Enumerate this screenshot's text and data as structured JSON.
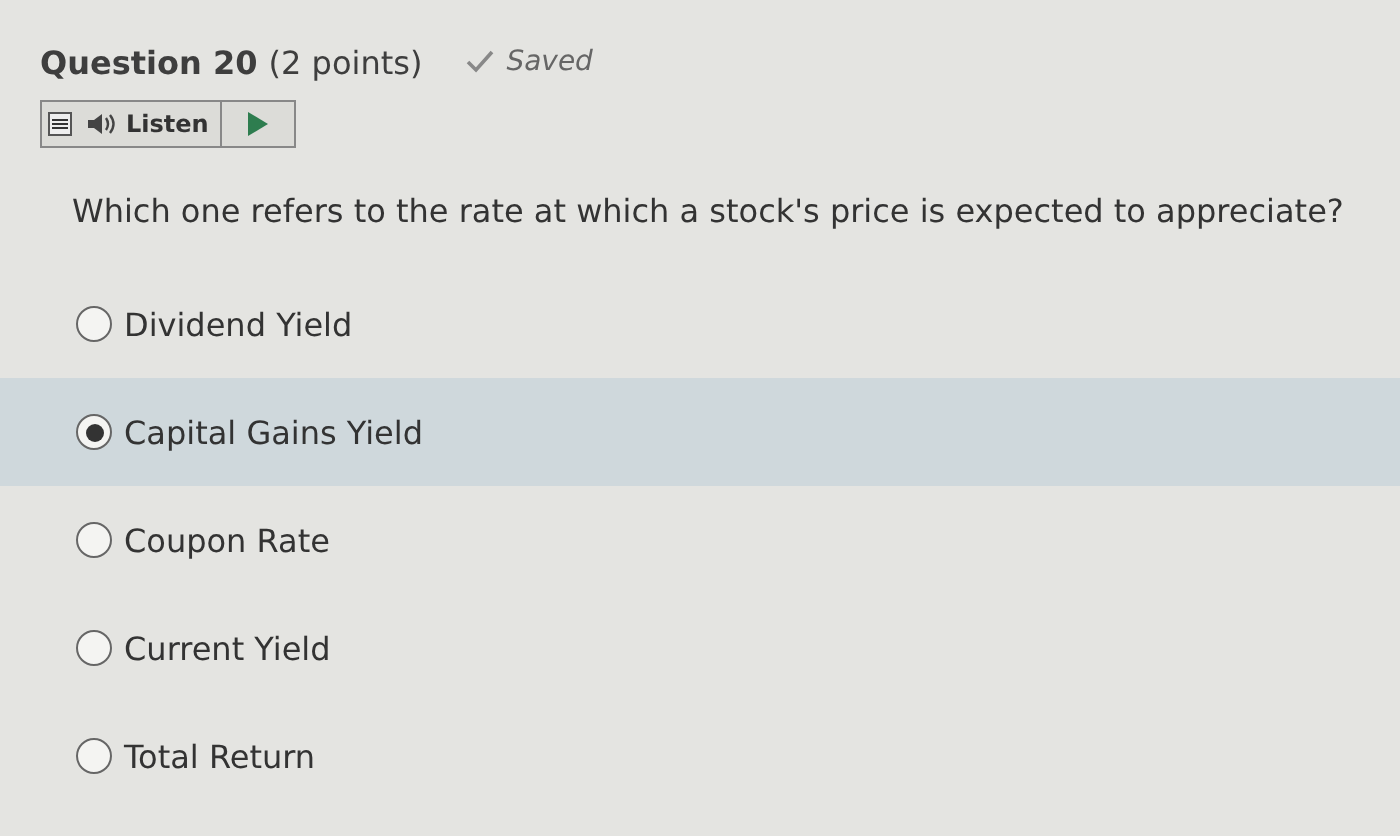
{
  "question": {
    "title": "Question 20",
    "points": "(2 points)",
    "status": "Saved",
    "listen": "Listen",
    "prompt": "Which one refers to the rate at which a stock's price is expected to appreciate?"
  },
  "options": [
    {
      "label": "Dividend Yield",
      "selected": false
    },
    {
      "label": "Capital Gains Yield",
      "selected": true
    },
    {
      "label": "Coupon Rate",
      "selected": false
    },
    {
      "label": "Current Yield",
      "selected": false
    },
    {
      "label": "Total Return",
      "selected": false
    }
  ]
}
